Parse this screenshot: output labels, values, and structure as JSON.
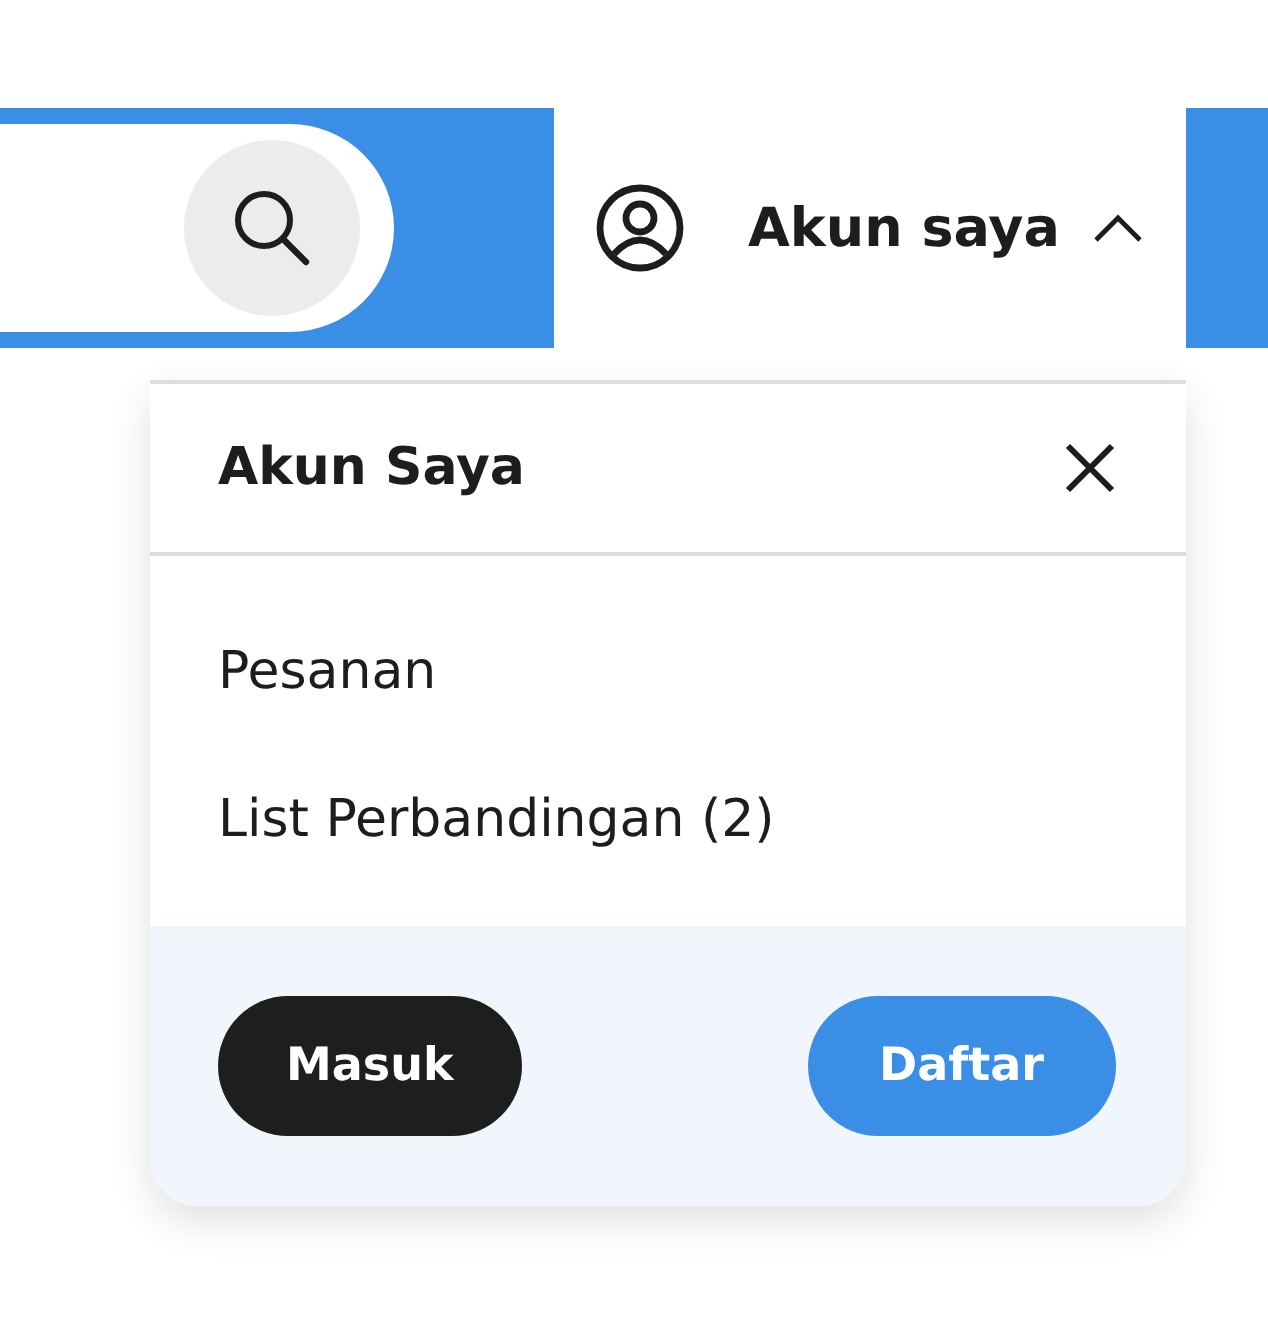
{
  "account": {
    "label": "Akun saya",
    "expanded": true
  },
  "dropdown": {
    "title": "Akun Saya",
    "items": [
      {
        "label": "Pesanan"
      },
      {
        "label": "List Perbandingan (2)"
      }
    ],
    "buttons": [
      {
        "label": "Masuk",
        "kind": "dark"
      },
      {
        "label": "Daftar",
        "kind": "primary"
      }
    ]
  }
}
